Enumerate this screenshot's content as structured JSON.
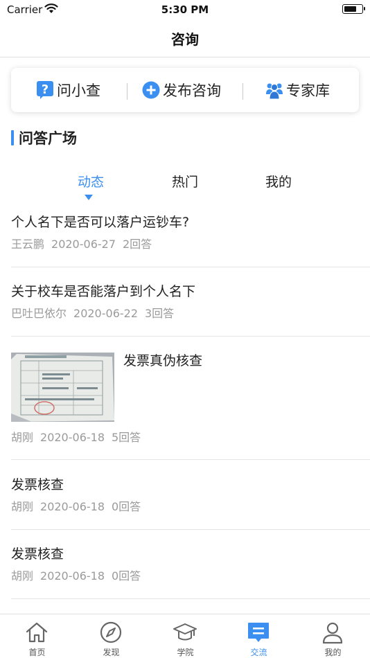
{
  "status_bar": {
    "carrier": "Carrier",
    "time": "5:30 PM",
    "battery_level": 0.7
  },
  "nav": {
    "title": "咨询"
  },
  "actions": [
    {
      "label": "问小查",
      "icon": "question-icon"
    },
    {
      "label": "发布咨询",
      "icon": "plus-circle-icon"
    },
    {
      "label": "专家库",
      "icon": "experts-icon"
    }
  ],
  "section": {
    "title": "问答广场"
  },
  "tabs": [
    {
      "label": "动态",
      "active": true
    },
    {
      "label": "热门",
      "active": false
    },
    {
      "label": "我的",
      "active": false
    }
  ],
  "posts": [
    {
      "title": "个人名下是否可以落户运钞车?",
      "author": "王云鹏",
      "date": "2020-06-27",
      "answers": "2回答"
    },
    {
      "title": "关于校车是否能落户到个人名下",
      "author": "巴吐巴依尔",
      "date": "2020-06-22",
      "answers": "3回答"
    },
    {
      "title": "发票真伪核查",
      "author": "胡刚",
      "date": "2020-06-18",
      "answers": "5回答",
      "has_image": true
    },
    {
      "title": "发票核查",
      "author": "胡刚",
      "date": "2020-06-18",
      "answers": "0回答"
    },
    {
      "title": "发票核查",
      "author": "胡刚",
      "date": "2020-06-18",
      "answers": "0回答"
    }
  ],
  "tab_bar": [
    {
      "label": "首页",
      "icon": "home-icon",
      "active": false
    },
    {
      "label": "发现",
      "icon": "compass-icon",
      "active": false
    },
    {
      "label": "学院",
      "icon": "graduation-cap-icon",
      "active": false
    },
    {
      "label": "交流",
      "icon": "chat-icon",
      "active": true
    },
    {
      "label": "我的",
      "icon": "person-icon",
      "active": false
    }
  ],
  "colors": {
    "accent": "#3b8ff0",
    "text": "#222222",
    "meta": "#9a9a9a"
  }
}
